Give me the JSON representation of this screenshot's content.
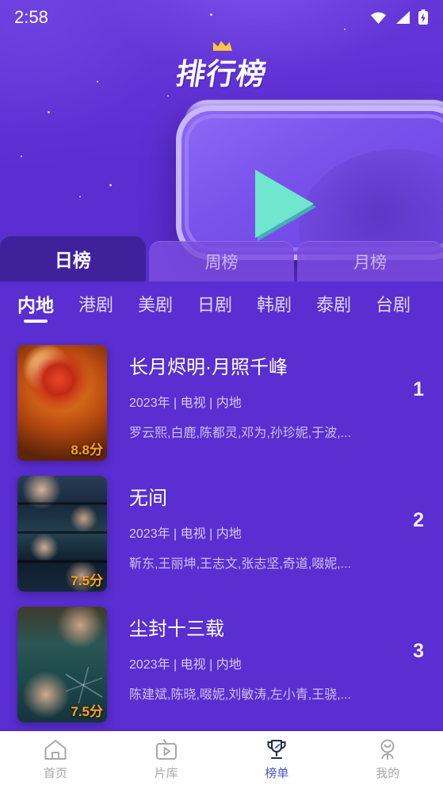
{
  "status_bar": {
    "time": "2:58",
    "icons": [
      "wifi-icon",
      "cellular-signal-icon",
      "battery-charging-icon"
    ]
  },
  "header": {
    "title": "排行榜",
    "crown_icon": "crown-icon",
    "banner_icon": "play-button-graphic",
    "accent_purple": "#5a2ed0",
    "accent_teal": "#6fe6cd"
  },
  "period_tabs": [
    {
      "label": "日榜",
      "active": true
    },
    {
      "label": "周榜",
      "active": false
    },
    {
      "label": "月榜",
      "active": false
    }
  ],
  "category_tabs": [
    {
      "label": "内地",
      "active": true
    },
    {
      "label": "港剧",
      "active": false
    },
    {
      "label": "美剧",
      "active": false
    },
    {
      "label": "日剧",
      "active": false
    },
    {
      "label": "韩剧",
      "active": false
    },
    {
      "label": "泰剧",
      "active": false
    },
    {
      "label": "台剧",
      "active": false
    }
  ],
  "list": [
    {
      "rank": "1",
      "title": "长月烬明·月照千峰",
      "meta": "2023年 | 电视 | 内地",
      "cast": "罗云熙,白鹿,陈都灵,邓为,孙珍妮,于波,...",
      "score": "8.8分",
      "poster": "poster-chang-yue-jin-ming"
    },
    {
      "rank": "2",
      "title": "无间",
      "meta": "2023年 | 电视 | 内地",
      "cast": "靳东,王丽坤,王志文,张志坚,奇道,啜妮,...",
      "score": "7.5分",
      "poster": "poster-wu-jian"
    },
    {
      "rank": "3",
      "title": "尘封十三载",
      "meta": "2023年 | 电视 | 内地",
      "cast": "陈建斌,陈晓,啜妮,刘敏涛,左小青,王骁,...",
      "score": "7.5分",
      "poster": "poster-chen-feng-shi-san-zai"
    }
  ],
  "bottom_nav": [
    {
      "label": "首页",
      "icon": "home-icon",
      "active": false
    },
    {
      "label": "片库",
      "icon": "tv-library-icon",
      "active": false
    },
    {
      "label": "榜单",
      "icon": "trophy-icon",
      "active": true
    },
    {
      "label": "我的",
      "icon": "user-profile-icon",
      "active": false
    }
  ],
  "colors": {
    "active_nav": "#4a56d6",
    "score": "#ffa41c",
    "tab_active_bg": "#40219c"
  }
}
